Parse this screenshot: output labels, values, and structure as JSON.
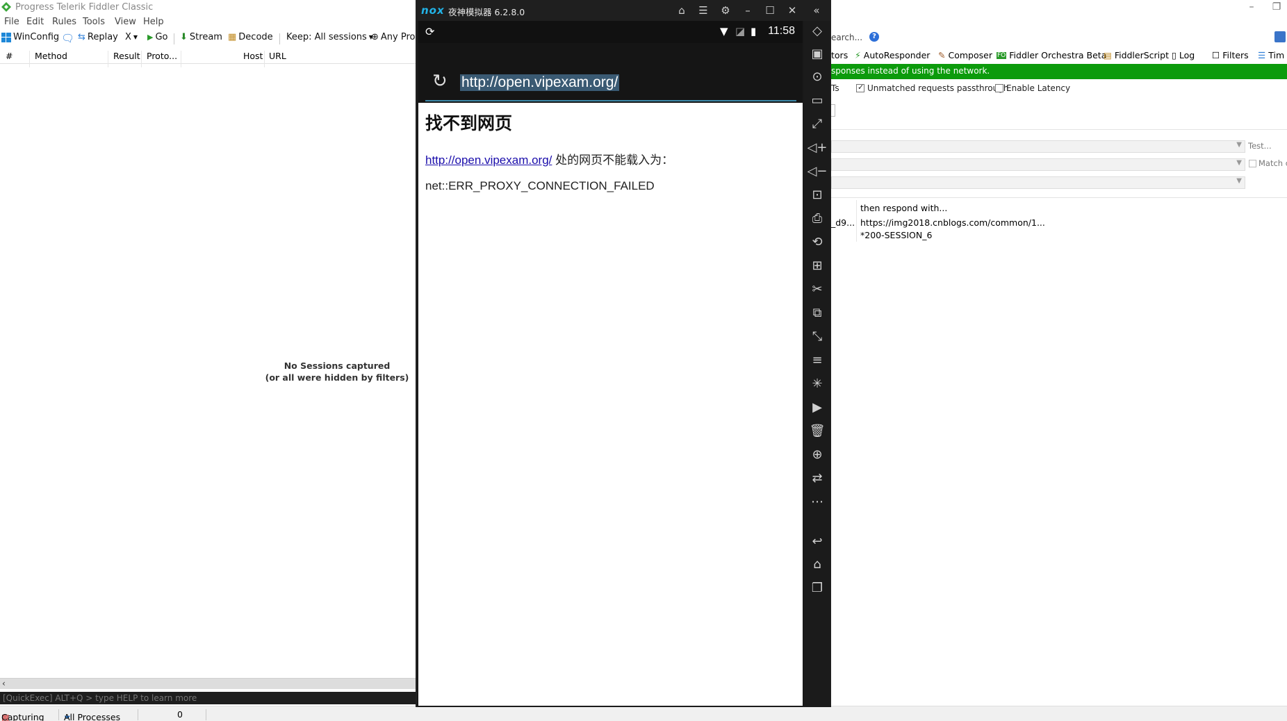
{
  "fiddler": {
    "title": "Progress Telerik Fiddler Classic",
    "menu": [
      "File",
      "Edit",
      "Rules",
      "Tools",
      "View",
      "Help"
    ],
    "toolbar": {
      "winconfig": "WinConfig",
      "replay": "Replay",
      "remove": "X",
      "go": "Go",
      "stream": "Stream",
      "decode": "Decode",
      "keep": "Keep: All sessions",
      "any_process": "Any Pro"
    },
    "columns": [
      "#",
      "Method",
      "Result",
      "Proto...",
      "Host",
      "URL"
    ],
    "empty_line1": "No Sessions captured",
    "empty_line2": "(or all were hidden by filters)",
    "quickexec": "[QuickExec] ALT+Q > type HELP to learn more",
    "status": {
      "capturing": "Capturing",
      "processes": "All Processes",
      "count": "0"
    },
    "right": {
      "search": "earch...",
      "tabs": [
        "tors",
        "AutoResponder",
        "Composer",
        "Fiddler Orchestra Beta",
        "FiddlerScript",
        "Log",
        "Filters",
        "Tim"
      ],
      "banner": "sponses instead of using the network.",
      "opt_ts": "Ts",
      "opt_unmatched": "Unmatched requests passthrough",
      "opt_latency": "Enable Latency",
      "test": "Test...",
      "match": "Match c",
      "rule_header": "then respond with...",
      "rule_left": "_d9...",
      "rule_url": "https://img2018.cnblogs.com/common/1...",
      "rule_session": "*200-SESSION_6"
    }
  },
  "nox": {
    "logo": "nox",
    "title": "夜神模拟器 6.2.8.0",
    "clock": "11:58",
    "url": "http://open.vipexam.org/",
    "heading": "找不到网页",
    "link": "http://open.vipexam.org/",
    "message_suffix": " 处的网页不能载入为：",
    "error": "net::ERR_PROXY_CONNECTION_FAILED"
  }
}
